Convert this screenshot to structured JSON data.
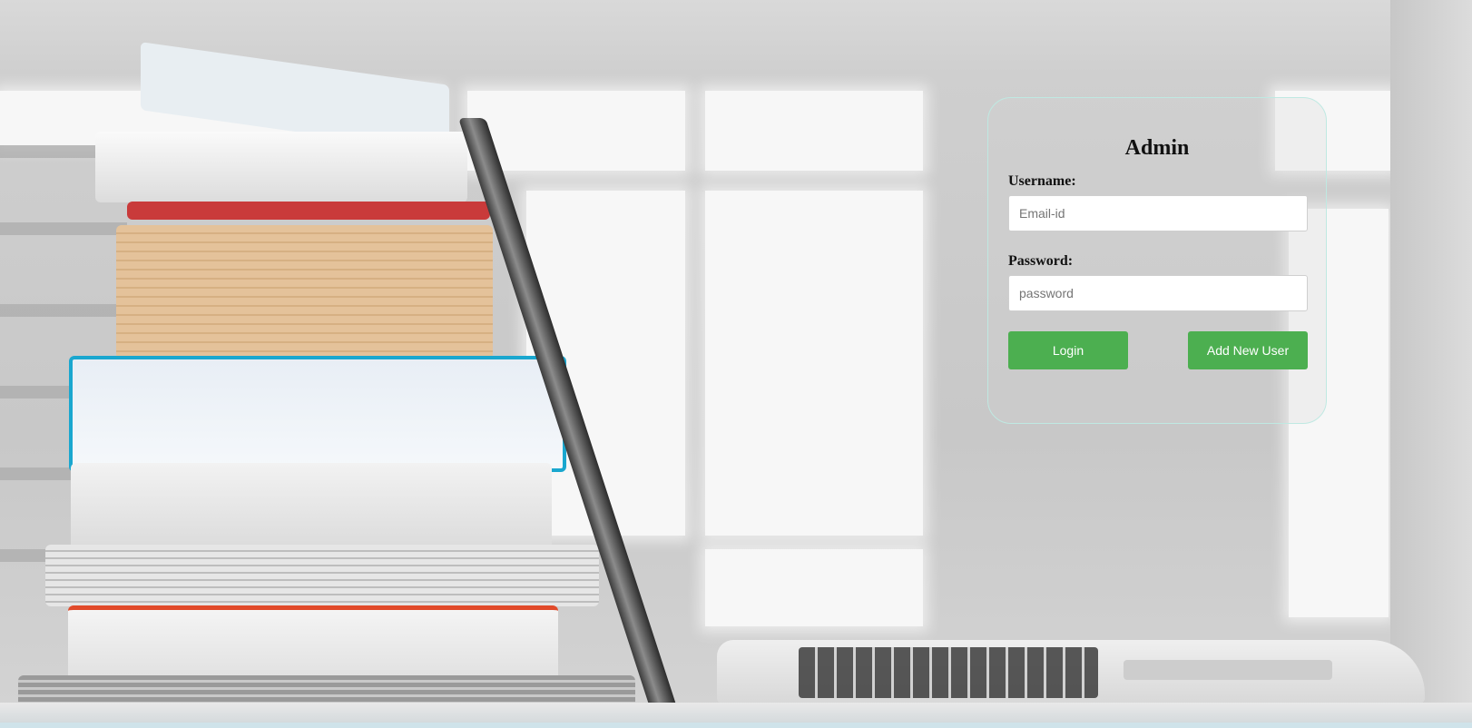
{
  "login": {
    "title": "Admin",
    "username_label": "Username:",
    "username_placeholder": "Email-id",
    "password_label": "Password:",
    "password_placeholder": "password",
    "login_button": "Login",
    "add_user_button": "Add New User"
  },
  "colors": {
    "button": "#4caf50",
    "card_border": "#bfe9e2"
  }
}
